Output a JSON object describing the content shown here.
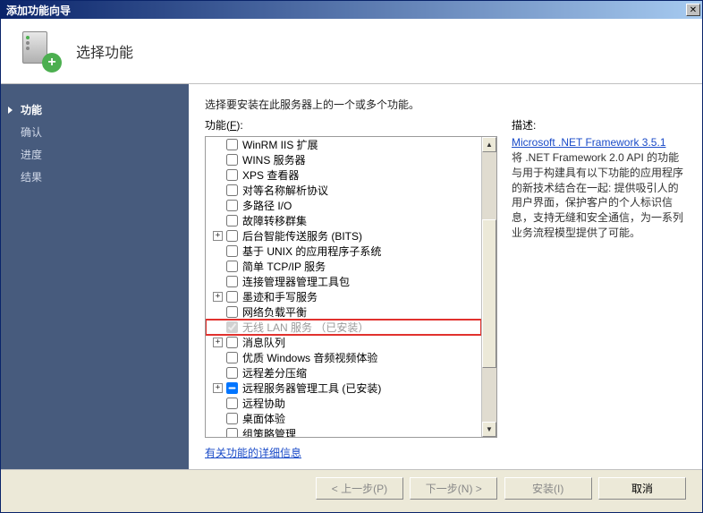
{
  "window": {
    "title": "添加功能向导"
  },
  "header": {
    "title": "选择功能"
  },
  "sidebar": {
    "items": [
      "功能",
      "确认",
      "进度",
      "结果"
    ]
  },
  "main": {
    "instruction": "选择要安装在此服务器上的一个或多个功能。",
    "features_label_prefix": "功能(",
    "features_label_hotkey": "F",
    "features_label_suffix": "):",
    "desc_label": "描述:",
    "more_link": "有关功能的详细信息",
    "tree": [
      {
        "label": "WinRM IIS 扩展",
        "checked": false,
        "expander": null,
        "disabled": false
      },
      {
        "label": "WINS 服务器",
        "checked": false,
        "expander": null,
        "disabled": false
      },
      {
        "label": "XPS 查看器",
        "checked": false,
        "expander": null,
        "disabled": false
      },
      {
        "label": "对等名称解析协议",
        "checked": false,
        "expander": null,
        "disabled": false
      },
      {
        "label": "多路径 I/O",
        "checked": false,
        "expander": null,
        "disabled": false
      },
      {
        "label": "故障转移群集",
        "checked": false,
        "expander": null,
        "disabled": false
      },
      {
        "label": "后台智能传送服务 (BITS)",
        "checked": false,
        "expander": "plus",
        "disabled": false
      },
      {
        "label": "基于 UNIX 的应用程序子系统",
        "checked": false,
        "expander": null,
        "disabled": false
      },
      {
        "label": "简单 TCP/IP 服务",
        "checked": false,
        "expander": null,
        "disabled": false
      },
      {
        "label": "连接管理器管理工具包",
        "checked": false,
        "expander": null,
        "disabled": false
      },
      {
        "label": "墨迹和手写服务",
        "checked": false,
        "expander": "plus",
        "disabled": false
      },
      {
        "label": "网络负载平衡",
        "checked": false,
        "expander": null,
        "disabled": false
      },
      {
        "label": "无线 LAN 服务  （已安装）",
        "checked": true,
        "expander": null,
        "disabled": true,
        "highlight": true
      },
      {
        "label": "消息队列",
        "checked": false,
        "expander": "plus",
        "disabled": false
      },
      {
        "label": "优质 Windows 音频视频体验",
        "checked": false,
        "expander": null,
        "disabled": false
      },
      {
        "label": "远程差分压缩",
        "checked": false,
        "expander": null,
        "disabled": false
      },
      {
        "label": "远程服务器管理工具  (已安装)",
        "checked": true,
        "expander": "plus",
        "disabled": false,
        "mixed": true
      },
      {
        "label": "远程协助",
        "checked": false,
        "expander": null,
        "disabled": false
      },
      {
        "label": "桌面体验",
        "checked": false,
        "expander": null,
        "disabled": false
      },
      {
        "label": "组策略管理",
        "checked": false,
        "expander": null,
        "disabled": false
      }
    ]
  },
  "description": {
    "link": "Microsoft .NET Framework 3.5.1",
    "text": "将 .NET Framework 2.0 API 的功能与用于构建具有以下功能的应用程序的新技术结合在一起: 提供吸引人的用户界面，保护客户的个人标识信息，支持无缝和安全通信，为一系列业务流程模型提供了可能。"
  },
  "footer": {
    "back": "< 上一步(P)",
    "next": "下一步(N) >",
    "install": "安装(I)",
    "cancel": "取消"
  }
}
